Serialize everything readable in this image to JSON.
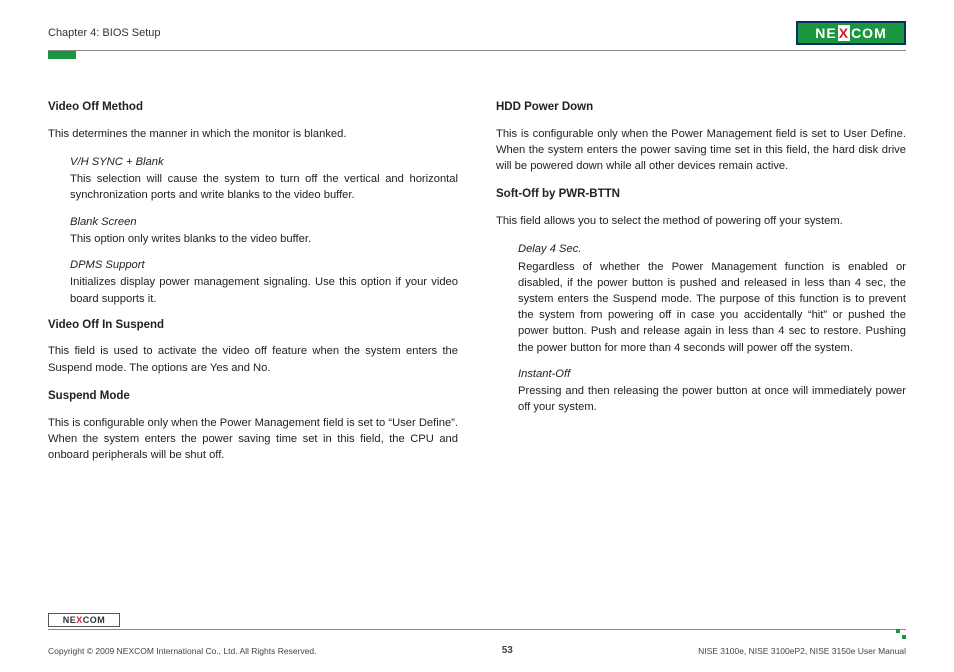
{
  "header": {
    "chapter": "Chapter 4: BIOS Setup",
    "logo_text_left": "NE",
    "logo_text_x": "X",
    "logo_text_right": "COM"
  },
  "left": {
    "s1": {
      "title": "Video Off Method",
      "intro": "This determines the manner in which the monitor is blanked.",
      "items": [
        {
          "name": "V/H SYNC + Blank",
          "text": "This selection will cause the system to turn off the vertical and horizontal synchronization ports and write blanks to the video buffer."
        },
        {
          "name": "Blank Screen",
          "text": "This option only writes blanks to the video buffer."
        },
        {
          "name": "DPMS Support",
          "text": "Initializes display power management signaling. Use this option if your video board supports it."
        }
      ]
    },
    "s2": {
      "title": "Video Off In Suspend",
      "text": "This field is used to activate the video off feature when the system enters the Suspend mode. The options are Yes and No."
    },
    "s3": {
      "title": "Suspend Mode",
      "text": "This is configurable only when the Power Management field is set to “User Define”. When the system enters the power saving time set in this field, the CPU and onboard peripherals will be shut off."
    }
  },
  "right": {
    "s1": {
      "title": "HDD Power Down",
      "text": "This is configurable only when the Power Management field is set to User Define. When the system enters the power saving time set in this field, the hard disk drive will be powered down while all other devices remain active."
    },
    "s2": {
      "title": "Soft-Off by PWR-BTTN",
      "intro": "This field allows you to select the method of powering off your system.",
      "items": [
        {
          "name": "Delay 4 Sec.",
          "text": "Regardless of whether the Power Management function is enabled or disabled, if the power button is pushed and released in less than 4 sec, the system enters the Suspend mode. The purpose of this function is to prevent the system from powering off in case you accidentally “hit” or pushed the power button. Push and release again in less than 4 sec to restore. Pushing the power button for more than 4 seconds will power off the system."
        },
        {
          "name": "Instant-Off",
          "text": "Pressing and then releasing the power button at once will immediately power off your system."
        }
      ]
    }
  },
  "footer": {
    "logo_left": "NE",
    "logo_x": "X",
    "logo_right": "COM",
    "copyright": "Copyright © 2009 NEXCOM International Co., Ltd. All Rights Reserved.",
    "page": "53",
    "doc": "NISE 3100e, NISE 3100eP2, NISE 3150e User Manual"
  }
}
